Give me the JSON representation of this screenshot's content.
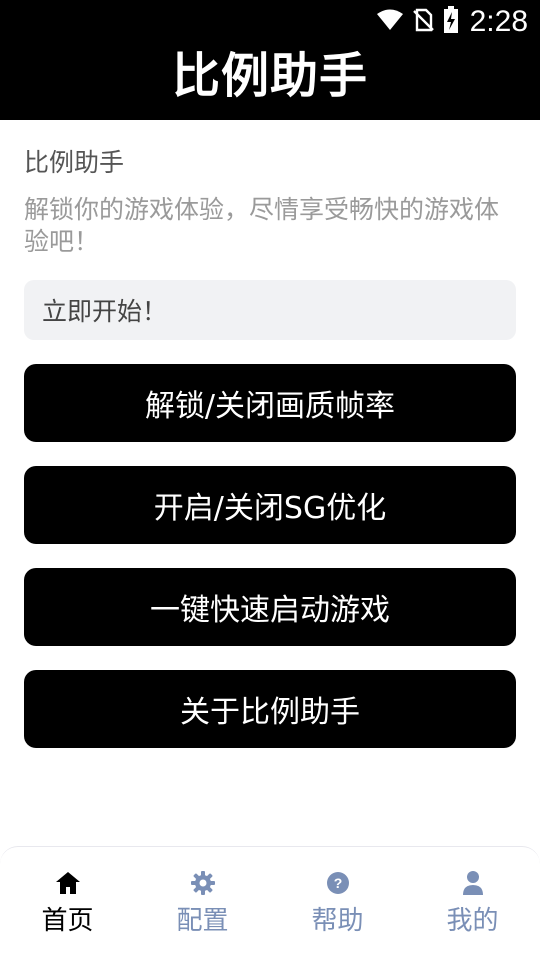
{
  "status_bar": {
    "time": "2:28",
    "icons": [
      "wifi-icon",
      "no-sim-icon",
      "battery-charging-icon"
    ]
  },
  "header": {
    "title": "比例助手"
  },
  "main": {
    "title": "比例助手",
    "description": "解锁你的游戏体验，尽情享受畅快的游戏体验吧！",
    "start_label": "立即开始！",
    "buttons": [
      {
        "label": "解锁/关闭画质帧率"
      },
      {
        "label": "开启/关闭SG优化"
      },
      {
        "label": "一键快速启动游戏"
      },
      {
        "label": "关于比例助手"
      }
    ]
  },
  "bottom_nav": {
    "active": "首页",
    "items": [
      {
        "label": "首页",
        "icon": "home-icon"
      },
      {
        "label": "配置",
        "icon": "gear-icon"
      },
      {
        "label": "帮助",
        "icon": "help-icon"
      },
      {
        "label": "我的",
        "icon": "user-icon"
      }
    ]
  },
  "colors": {
    "header_bg": "#000000",
    "button_bg": "#000000",
    "field_bg": "#f1f2f4",
    "nav_inactive": "#7a8fb6",
    "nav_active": "#000000"
  }
}
